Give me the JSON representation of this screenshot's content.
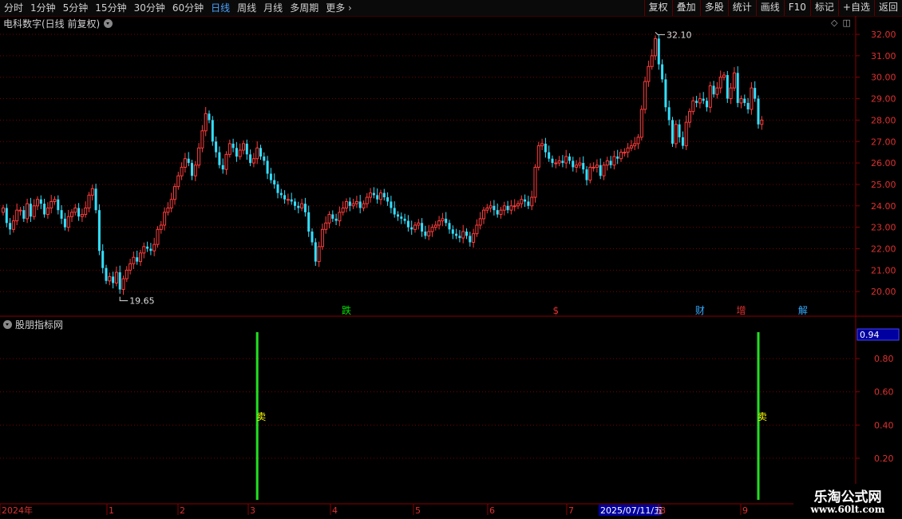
{
  "toolbar": {
    "periods": [
      "分时",
      "1分钟",
      "5分钟",
      "15分钟",
      "30分钟",
      "60分钟",
      "日线",
      "周线",
      "月线",
      "多周期",
      "更多"
    ],
    "active_period": "日线",
    "more_arrow": "›",
    "right_buttons": [
      "复权",
      "叠加",
      "多股",
      "统计",
      "画线",
      "F10",
      "标记",
      "+自选",
      "返回"
    ]
  },
  "main_panel": {
    "title": "电科数字(日线 前复权)",
    "icons": [
      "diamond-icon",
      "panel-toggle-icon"
    ]
  },
  "indicator_panel": {
    "title": "股朋指标网",
    "current_value": "0.94"
  },
  "signals": [
    {
      "label": "卖",
      "x_index": 74
    },
    {
      "label": "卖",
      "x_index": 220
    }
  ],
  "events": [
    {
      "label": "跌",
      "color": "#00e000",
      "x_index": 100
    },
    {
      "label": "$",
      "color": "#e03030",
      "x_index": 161
    },
    {
      "label": "财",
      "color": "#33aaff",
      "x_index": 203
    },
    {
      "label": "增",
      "color": "#e03030",
      "x_index": 215
    },
    {
      "label": "解",
      "color": "#33aaff",
      "x_index": 233
    }
  ],
  "logo": {
    "main": "乐淘公式网",
    "sub": "www.60lt.com"
  },
  "chart_data": [
    {
      "type": "candlestick",
      "title": "电科数字(日线 前复权)",
      "ylim": [
        19.5,
        32.4
      ],
      "y_ticks": [
        "32.00",
        "31.00",
        "30.00",
        "29.00",
        "28.00",
        "27.00",
        "26.00",
        "25.00",
        "24.00",
        "23.00",
        "22.00",
        "21.00",
        "20.00"
      ],
      "max_label": "32.10",
      "min_label": "19.65",
      "x_labels": [
        "2024年",
        "1",
        "2",
        "3",
        "4",
        "5",
        "6",
        "7",
        "2025/07/11/五",
        "8",
        "9"
      ],
      "colors": {
        "up": "#ff3c3c",
        "down": "#33e0ff"
      },
      "closes": [
        23.9,
        23.2,
        22.9,
        23.3,
        23.8,
        23.8,
        23.4,
        24.1,
        23.5,
        24.0,
        24.3,
        24.1,
        23.6,
        23.9,
        24.2,
        24.3,
        23.8,
        23.4,
        23.0,
        23.5,
        23.7,
        23.9,
        23.5,
        23.6,
        23.9,
        24.5,
        24.8,
        23.8,
        21.9,
        21.1,
        20.5,
        20.7,
        20.4,
        20.9,
        20.1,
        20.6,
        21.0,
        21.3,
        21.6,
        21.4,
        21.8,
        22.1,
        22.0,
        21.9,
        22.2,
        22.9,
        23.1,
        23.7,
        23.9,
        24.3,
        24.9,
        25.4,
        25.8,
        26.2,
        26.0,
        25.4,
        25.9,
        26.7,
        27.5,
        28.3,
        28.0,
        27.0,
        26.5,
        25.9,
        25.7,
        26.4,
        26.9,
        26.7,
        26.3,
        26.6,
        26.9,
        26.4,
        26.0,
        26.2,
        26.7,
        26.3,
        26.1,
        25.5,
        25.2,
        25.0,
        24.6,
        24.5,
        24.3,
        24.3,
        24.2,
        24.0,
        23.9,
        24.1,
        23.7,
        22.8,
        22.3,
        21.4,
        22.1,
        22.9,
        23.2,
        23.6,
        23.4,
        23.3,
        23.7,
        23.9,
        24.2,
        24.0,
        24.1,
        24.2,
        23.9,
        24.1,
        24.4,
        24.6,
        24.5,
        24.3,
        24.6,
        24.4,
        24.2,
        23.9,
        23.6,
        23.5,
        23.4,
        23.3,
        23.0,
        22.9,
        23.1,
        23.2,
        22.8,
        22.6,
        22.8,
        23.0,
        23.1,
        23.3,
        23.4,
        23.2,
        22.9,
        22.7,
        22.6,
        22.5,
        22.8,
        22.6,
        22.3,
        22.7,
        23.1,
        23.4,
        23.8,
        23.9,
        24.0,
        23.8,
        23.6,
        23.8,
        24.0,
        23.8,
        24.0,
        24.0,
        24.1,
        24.3,
        24.2,
        24.0,
        24.4,
        25.8,
        26.8,
        26.9,
        26.5,
        26.2,
        26.0,
        26.0,
        26.1,
        26.0,
        26.3,
        26.1,
        25.8,
        25.9,
        26.0,
        25.7,
        25.2,
        25.8,
        25.8,
        25.9,
        25.4,
        25.9,
        26.1,
        25.9,
        26.3,
        26.2,
        26.5,
        26.5,
        26.7,
        26.8,
        26.9,
        27.2,
        28.5,
        29.8,
        30.5,
        31.0,
        31.8,
        30.6,
        29.9,
        28.6,
        28.0,
        26.9,
        27.8,
        27.2,
        26.8,
        27.9,
        28.4,
        28.9,
        28.8,
        29.0,
        28.9,
        28.6,
        29.6,
        29.2,
        29.5,
        30.0,
        30.1,
        29.0,
        29.5,
        30.2,
        28.8,
        29.0,
        28.8,
        28.5,
        29.5,
        29.0,
        27.8,
        28.0
      ]
    },
    {
      "type": "bar",
      "title": "股朋指标网",
      "ylim": [
        0.1,
        0.97
      ],
      "y_ticks": [
        "0.80",
        "0.60",
        "0.40",
        "0.20"
      ],
      "signal_value": 1.0,
      "signal_color": "#22e022"
    }
  ]
}
